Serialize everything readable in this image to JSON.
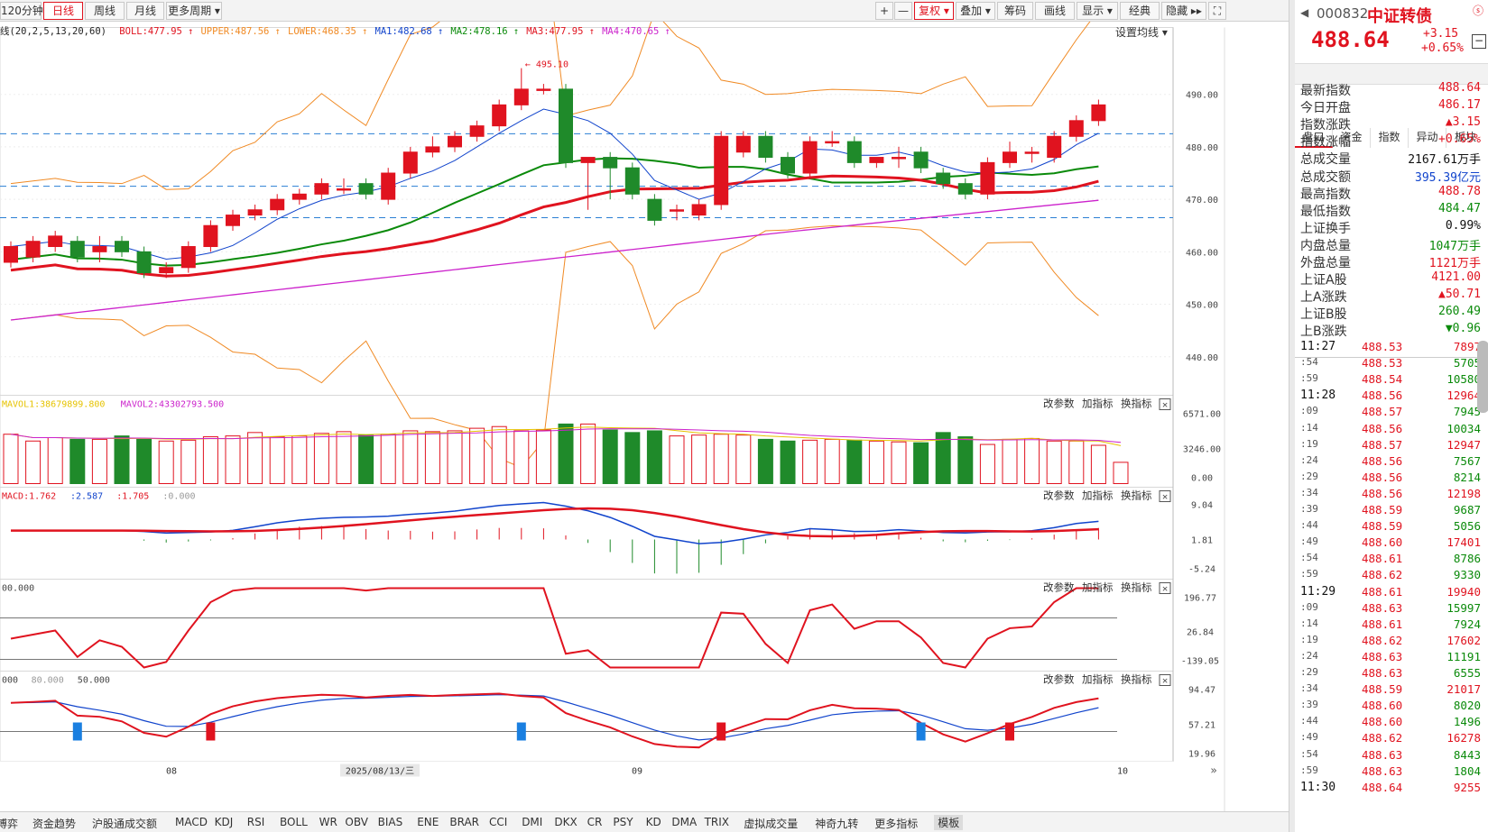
{
  "toolbar": {
    "period_items": [
      "120分钟",
      "日线",
      "周线",
      "月线",
      "更多周期 ▾"
    ],
    "active_period": "日线",
    "right_items": [
      "+",
      "—",
      "复权 ▾",
      "叠加 ▾",
      "筹码",
      "画线",
      "显示 ▾",
      "经典",
      "隐藏 ▸▸"
    ]
  },
  "main_legend": {
    "prefix": "线(20,2,5,13,20,60)",
    "items": [
      {
        "text": "BOLL:477.95",
        "color": "#e0131f"
      },
      {
        "text": "UPPER:487.56",
        "color": "#f08a24"
      },
      {
        "text": "LOWER:468.35",
        "color": "#f08a24"
      },
      {
        "text": "MA1:482.68",
        "color": "#1144cc"
      },
      {
        "text": "MA2:478.16",
        "color": "#0a8a0a"
      },
      {
        "text": "MA3:477.95",
        "color": "#e0131f"
      },
      {
        "text": "MA4:470.65",
        "color": "#cc22cc"
      }
    ],
    "setting": "设置均线 ▾",
    "max_label": "495.10"
  },
  "panel_buttons": [
    "改参数",
    "加指标",
    "换指标"
  ],
  "vol_legend": [
    {
      "text": "MAVOL1:38679899.800",
      "color": "#e6c300"
    },
    {
      "text": "MAVOL2:43302793.500",
      "color": "#cc22cc"
    }
  ],
  "macd_legend": [
    {
      "text": "MACD:1.762",
      "color": "#e0131f"
    },
    {
      "text": ":2.587",
      "color": "#1144cc"
    },
    {
      "text": ":1.705",
      "color": "#e0131f"
    },
    {
      "text": ":0.000",
      "color": "#999999"
    }
  ],
  "cci_legend": [
    {
      "text": "00.000",
      "color": "#444444"
    }
  ],
  "kdj_legend": [
    {
      "text": "000",
      "color": "#444444"
    },
    {
      "text": "80.000",
      "color": "#999999"
    },
    {
      "text": "50.000",
      "color": "#444444"
    }
  ],
  "axes": {
    "price": [
      "490.00",
      "480.00",
      "470.00",
      "460.00",
      "450.00",
      "440.00"
    ],
    "vol": [
      "6571.00",
      "3246.00",
      "0.00"
    ],
    "macd": [
      "9.04",
      "1.81",
      "-5.24"
    ],
    "cci": [
      "196.77",
      "26.84",
      "-139.05"
    ],
    "kdj": [
      "94.47",
      "57.21",
      "19.96"
    ]
  },
  "x_axis": {
    "labels": [
      "08",
      "2025/08/13/三",
      "09",
      "10"
    ]
  },
  "bottom_tabs": [
    "博弈",
    "资金趋势",
    "沪股通成交额",
    "MACD",
    "KDJ",
    "RSI",
    "BOLL",
    "WR",
    "OBV",
    "BIAS",
    "ENE",
    "BRAR",
    "CCI",
    "DMI",
    "DKX",
    "CR",
    "PSY",
    "KD",
    "DMA",
    "TRIX",
    "虚拟成交量",
    "神奇九转",
    "更多指标",
    "模板"
  ],
  "active_bottom_tab": "模板",
  "chart_data": {
    "type": "candlestick",
    "y_range": [
      433,
      500
    ],
    "candles": [
      [
        458,
        461,
        457,
        462
      ],
      [
        459,
        462,
        458,
        463
      ],
      [
        461,
        463,
        460,
        464
      ],
      [
        462,
        459,
        458,
        463
      ],
      [
        460,
        461,
        458,
        463
      ],
      [
        462,
        460,
        459,
        463
      ],
      [
        460,
        456,
        455,
        461
      ],
      [
        456,
        457,
        455,
        458
      ],
      [
        457,
        461,
        456,
        462
      ],
      [
        461,
        465,
        460,
        466
      ],
      [
        465,
        467,
        464,
        468
      ],
      [
        467,
        468,
        466,
        469
      ],
      [
        468,
        470,
        467,
        471
      ],
      [
        470,
        471,
        469,
        472
      ],
      [
        471,
        473,
        470,
        474
      ],
      [
        472,
        472,
        471,
        474
      ],
      [
        473,
        471,
        470,
        474
      ],
      [
        470,
        475,
        469,
        476
      ],
      [
        475,
        479,
        474,
        480
      ],
      [
        479,
        480,
        478,
        482
      ],
      [
        480,
        482,
        479,
        483
      ],
      [
        482,
        484,
        481,
        485
      ],
      [
        484,
        488,
        483,
        489
      ],
      [
        488,
        491,
        487,
        495
      ],
      [
        491,
        491,
        490,
        492
      ],
      [
        491,
        477,
        476,
        492
      ],
      [
        477,
        478,
        468,
        478
      ],
      [
        478,
        476,
        470,
        479
      ],
      [
        476,
        471,
        470,
        477
      ],
      [
        470,
        466,
        465,
        471
      ],
      [
        468,
        468,
        466,
        469
      ],
      [
        467,
        469,
        466,
        470
      ],
      [
        469,
        482,
        468,
        483
      ],
      [
        479,
        482,
        478,
        483
      ],
      [
        482,
        478,
        477,
        483
      ],
      [
        478,
        475,
        474,
        479
      ],
      [
        475,
        481,
        474,
        482
      ],
      [
        481,
        481,
        480,
        483
      ],
      [
        481,
        477,
        476,
        482
      ],
      [
        477,
        478,
        476,
        478
      ],
      [
        478,
        478,
        476,
        480
      ],
      [
        479,
        476,
        475,
        480
      ],
      [
        475,
        473,
        472,
        476
      ],
      [
        473,
        471,
        470,
        474
      ],
      [
        471,
        477,
        470,
        478
      ],
      [
        477,
        479,
        476,
        481
      ],
      [
        479,
        479,
        477,
        480
      ],
      [
        478,
        482,
        477,
        483
      ],
      [
        482,
        485,
        481,
        486
      ],
      [
        485,
        488,
        484,
        489
      ]
    ],
    "volume": [
      [
        58,
        1
      ],
      [
        50,
        0
      ],
      [
        54,
        0
      ],
      [
        52,
        1
      ],
      [
        52,
        0
      ],
      [
        56,
        1
      ],
      [
        52,
        1
      ],
      [
        50,
        0
      ],
      [
        51,
        0
      ],
      [
        55,
        0
      ],
      [
        56,
        0
      ],
      [
        60,
        1
      ],
      [
        55,
        0
      ],
      [
        56,
        0
      ],
      [
        59,
        0
      ],
      [
        61,
        0
      ],
      [
        57,
        1
      ],
      [
        58,
        0
      ],
      [
        62,
        0
      ],
      [
        61,
        0
      ],
      [
        62,
        0
      ],
      [
        65,
        0
      ],
      [
        67,
        0
      ],
      [
        62,
        0
      ],
      [
        63,
        1
      ],
      [
        70,
        1
      ],
      [
        70,
        0
      ],
      [
        63,
        1
      ],
      [
        60,
        1
      ],
      [
        62,
        1
      ],
      [
        56,
        0
      ],
      [
        57,
        1
      ],
      [
        58,
        0
      ],
      [
        57,
        0
      ],
      [
        52,
        1
      ],
      [
        50,
        1
      ],
      [
        51,
        0
      ],
      [
        52,
        0
      ],
      [
        51,
        0
      ],
      [
        50,
        1
      ],
      [
        49,
        1
      ],
      [
        48,
        0
      ],
      [
        60,
        1
      ],
      [
        55,
        1
      ],
      [
        46,
        1
      ],
      [
        52,
        1
      ],
      [
        53,
        0
      ],
      [
        50,
        0
      ],
      [
        50,
        0
      ],
      [
        45,
        0
      ],
      [
        25,
        0
      ]
    ]
  },
  "right_panel": {
    "code": "000832",
    "name": "中证转债",
    "price": "488.64",
    "change": "+3.15",
    "change_pct": "+0.65%",
    "tabs": [
      "盘口",
      "资金",
      "指数",
      "异动",
      "板块"
    ],
    "active_tab": "盘口",
    "quotes": [
      {
        "k": "最新指数",
        "v": "488.64",
        "c": "red"
      },
      {
        "k": "今日开盘",
        "v": "486.17",
        "c": "red"
      },
      {
        "k": "指数涨跌",
        "v": "▲3.15",
        "c": "red"
      },
      {
        "k": "指数涨幅",
        "v": "+0.65%",
        "c": "red"
      },
      {
        "k": "总成交量",
        "v": "2167.61万手",
        "c": "dark"
      },
      {
        "k": "总成交额",
        "v": "395.39亿元",
        "c": "blue"
      },
      {
        "k": "最高指数",
        "v": "488.78",
        "c": "red"
      },
      {
        "k": "最低指数",
        "v": "484.47",
        "c": "green"
      },
      {
        "k": "上证换手",
        "v": "0.99%",
        "c": "dark"
      },
      {
        "k": "内盘总量",
        "v": "1047万手",
        "c": "green"
      },
      {
        "k": "外盘总量",
        "v": "1121万手",
        "c": "red"
      },
      {
        "k": "上证A股",
        "v": "4121.00",
        "c": "red"
      },
      {
        "k": "上A涨跌",
        "v": "▲50.71",
        "c": "red"
      },
      {
        "k": "上证B股",
        "v": "260.49",
        "c": "green"
      },
      {
        "k": "上B涨跌",
        "v": "▼0.96",
        "c": "green"
      }
    ],
    "ticks": [
      {
        "t": "11:27",
        "p": "488.53",
        "v": "7897",
        "bold": true
      },
      {
        "t": ":54",
        "p": "488.53",
        "v": "5705"
      },
      {
        "t": ":59",
        "p": "488.54",
        "v": "10580"
      },
      {
        "t": "11:28",
        "p": "488.56",
        "v": "12964",
        "bold": true
      },
      {
        "t": ":09",
        "p": "488.57",
        "v": "7945"
      },
      {
        "t": ":14",
        "p": "488.56",
        "v": "10034"
      },
      {
        "t": ":19",
        "p": "488.57",
        "v": "12947"
      },
      {
        "t": ":24",
        "p": "488.56",
        "v": "7567"
      },
      {
        "t": ":29",
        "p": "488.56",
        "v": "8214"
      },
      {
        "t": ":34",
        "p": "488.56",
        "v": "12198"
      },
      {
        "t": ":39",
        "p": "488.59",
        "v": "9687"
      },
      {
        "t": ":44",
        "p": "488.59",
        "v": "5056"
      },
      {
        "t": ":49",
        "p": "488.60",
        "v": "17401"
      },
      {
        "t": ":54",
        "p": "488.61",
        "v": "8786"
      },
      {
        "t": ":59",
        "p": "488.62",
        "v": "9330"
      },
      {
        "t": "11:29",
        "p": "488.61",
        "v": "19940",
        "bold": true
      },
      {
        "t": ":09",
        "p": "488.63",
        "v": "15997"
      },
      {
        "t": ":14",
        "p": "488.61",
        "v": "7924"
      },
      {
        "t": ":19",
        "p": "488.62",
        "v": "17602"
      },
      {
        "t": ":24",
        "p": "488.63",
        "v": "11191"
      },
      {
        "t": ":29",
        "p": "488.63",
        "v": "6555"
      },
      {
        "t": ":34",
        "p": "488.59",
        "v": "21017"
      },
      {
        "t": ":39",
        "p": "488.60",
        "v": "8020"
      },
      {
        "t": ":44",
        "p": "488.60",
        "v": "1496"
      },
      {
        "t": ":49",
        "p": "488.62",
        "v": "16278"
      },
      {
        "t": ":54",
        "p": "488.63",
        "v": "8443"
      },
      {
        "t": ":59",
        "p": "488.63",
        "v": "1804"
      },
      {
        "t": "11:30",
        "p": "488.64",
        "v": "9255",
        "bold": true
      }
    ]
  }
}
